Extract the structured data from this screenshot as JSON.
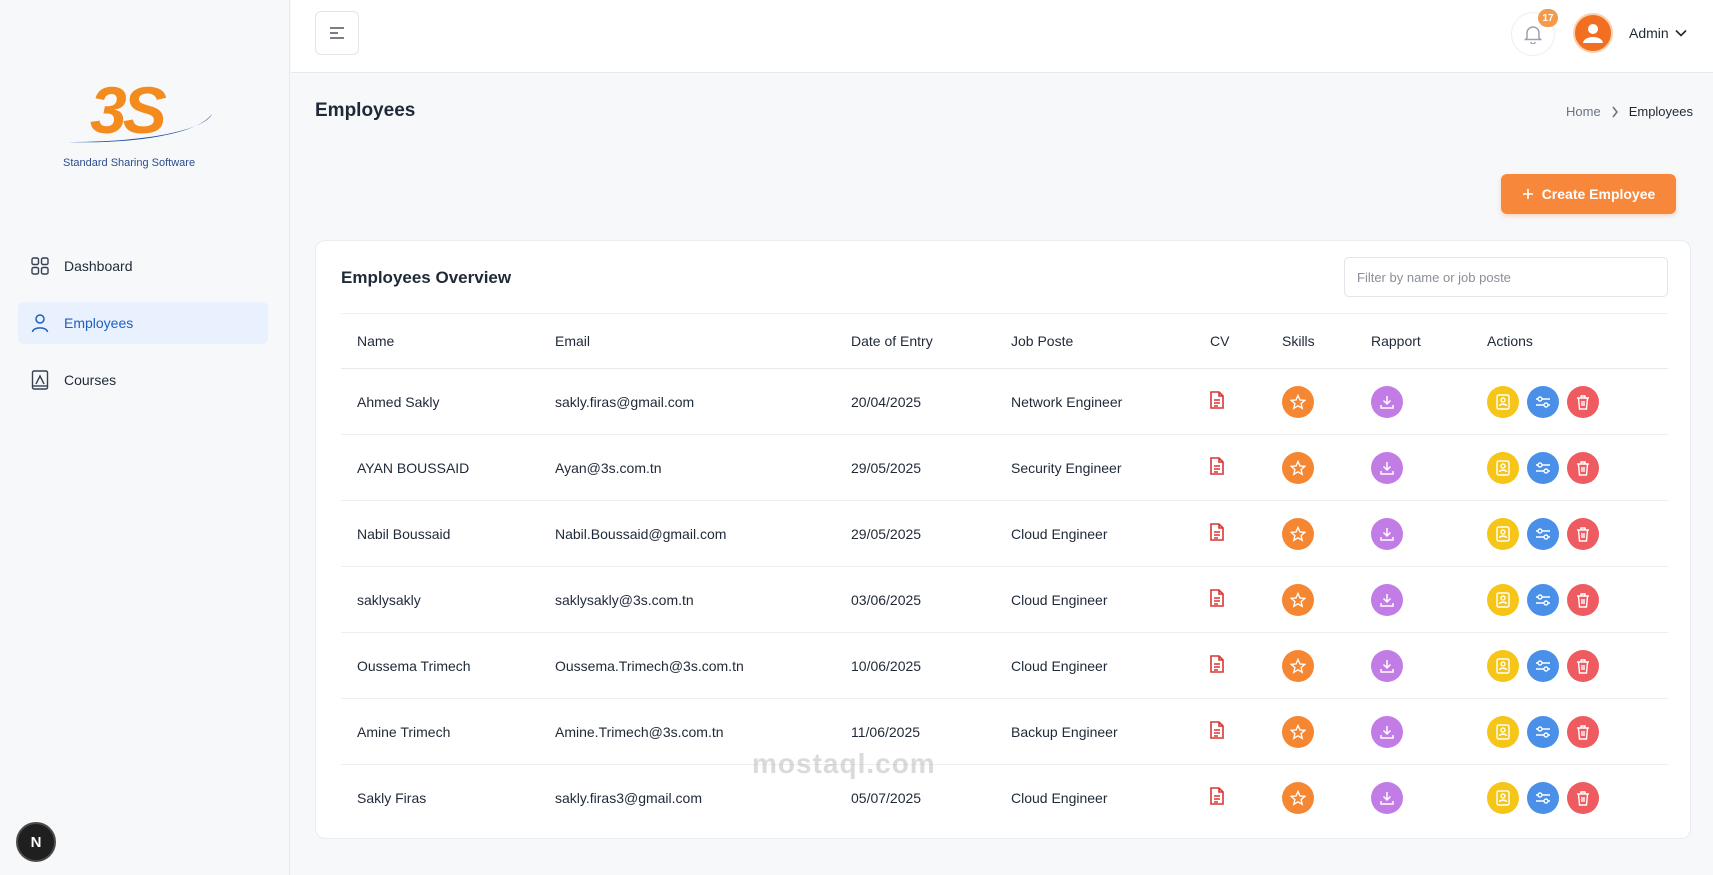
{
  "brand": {
    "logo_text": "3S",
    "tagline": "Standard Sharing Software",
    "accent": "#f7883b"
  },
  "sidebar": {
    "items": [
      {
        "label": "Dashboard",
        "icon": "grid-icon",
        "active": false
      },
      {
        "label": "Employees",
        "icon": "user-icon",
        "active": true
      },
      {
        "label": "Courses",
        "icon": "book-icon",
        "active": false
      }
    ],
    "bottom_badge": "N"
  },
  "topbar": {
    "notification_count": "17",
    "user_name": "Admin"
  },
  "page": {
    "title": "Employees",
    "breadcrumb": {
      "home": "Home",
      "current": "Employees"
    },
    "create_button": "Create Employee"
  },
  "card": {
    "title": "Employees Overview",
    "filter_placeholder": "Filter by name or job poste",
    "columns": [
      "Name",
      "Email",
      "Date of Entry",
      "Job Poste",
      "CV",
      "Skills",
      "Rapport",
      "Actions"
    ],
    "rows": [
      {
        "name": "Ahmed Sakly",
        "email": "sakly.firas@gmail.com",
        "date": "20/04/2025",
        "job": "Network Engineer"
      },
      {
        "name": "AYAN BOUSSAID",
        "email": "Ayan@3s.com.tn",
        "date": "29/05/2025",
        "job": "Security Engineer"
      },
      {
        "name": "Nabil Boussaid",
        "email": "Nabil.Boussaid@gmail.com",
        "date": "29/05/2025",
        "job": "Cloud Engineer"
      },
      {
        "name": "saklysakly",
        "email": "saklysakly@3s.com.tn",
        "date": "03/06/2025",
        "job": "Cloud Engineer"
      },
      {
        "name": "Oussema Trimech",
        "email": "Oussema.Trimech@3s.com.tn",
        "date": "10/06/2025",
        "job": "Cloud Engineer"
      },
      {
        "name": "Amine Trimech",
        "email": "Amine.Trimech@3s.com.tn",
        "date": "11/06/2025",
        "job": "Backup Engineer"
      },
      {
        "name": "Sakly Firas",
        "email": "sakly.firas3@gmail.com",
        "date": "05/07/2025",
        "job": "Cloud Engineer"
      }
    ]
  },
  "watermark": "mostaql.com"
}
